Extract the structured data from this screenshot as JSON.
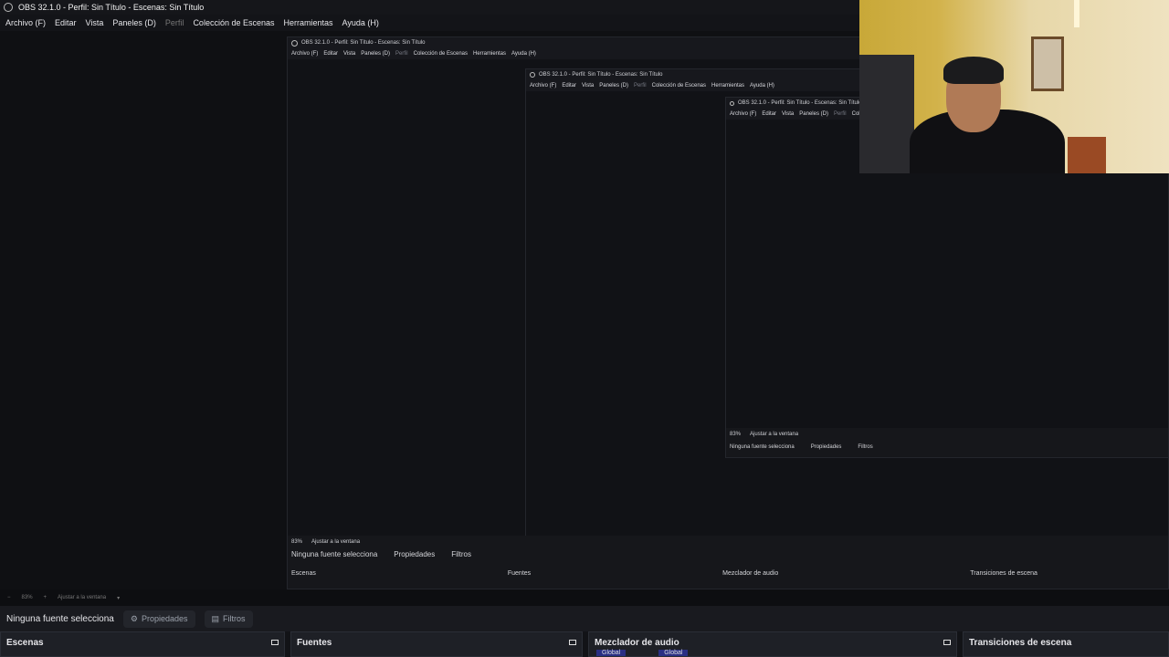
{
  "window": {
    "title": "OBS 32.1.0 - Perfil: Sin Título - Escenas: Sin Título"
  },
  "menu": {
    "items": [
      "Archivo (F)",
      "Editar",
      "Vista",
      "Paneles (D)",
      "Perfil",
      "Colección de Escenas",
      "Herramientas",
      "Ayuda (H)"
    ],
    "disabled_index": 4
  },
  "toolbar": {
    "zoom": "83%",
    "fit": "Ajustar a la ventana"
  },
  "selection": {
    "text": "Ninguna fuente selecciona",
    "properties": "Propiedades",
    "filters": "Filtros"
  },
  "docks": {
    "scenes": "Escenas",
    "sources": "Fuentes",
    "mixer": "Mezclador de audio",
    "transitions": "Transiciones de escena",
    "mixer_tags": [
      "Global",
      "Global"
    ]
  }
}
